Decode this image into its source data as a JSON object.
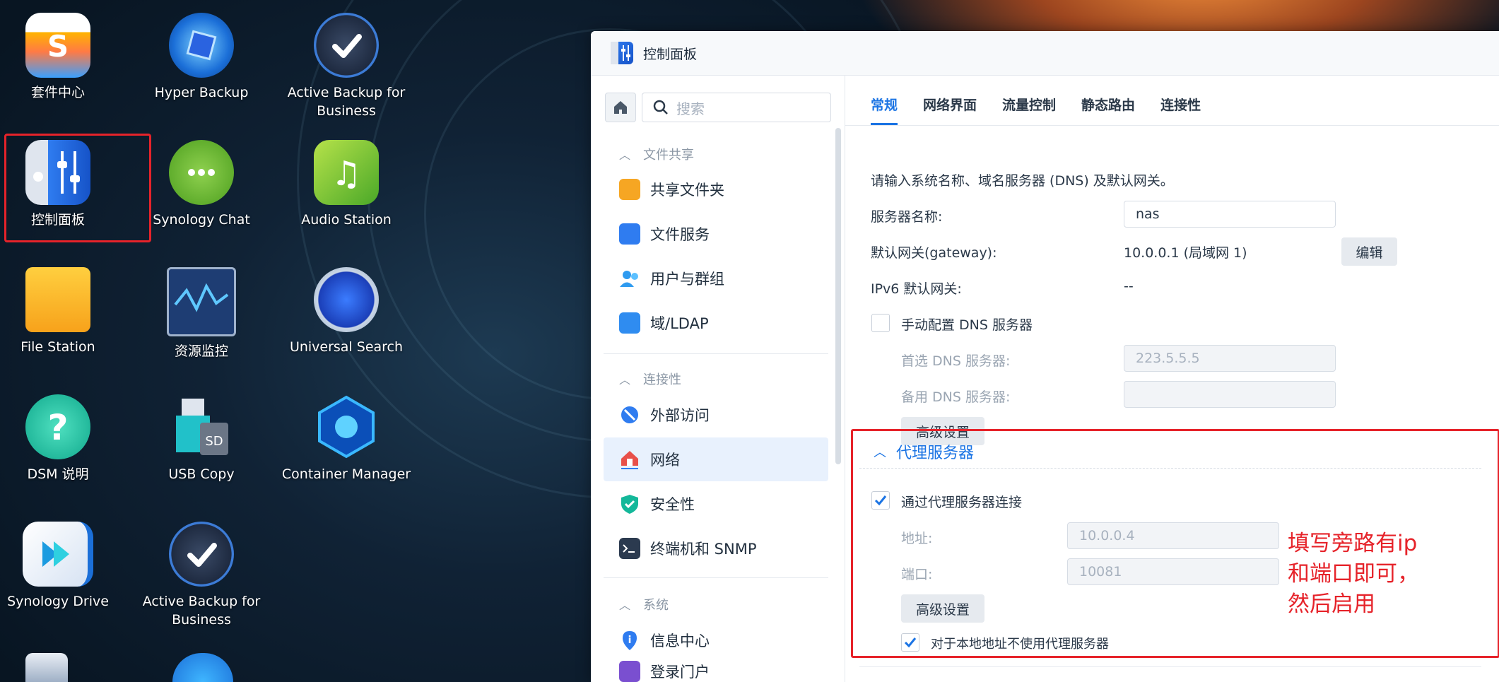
{
  "desktop": {
    "icons": [
      {
        "label": "套件中心"
      },
      {
        "label": "Hyper Backup"
      },
      {
        "label": "Active Backup for Business"
      },
      {
        "label": "控制面板"
      },
      {
        "label": "Synology Chat"
      },
      {
        "label": "Audio Station"
      },
      {
        "label": "File Station"
      },
      {
        "label": "资源监控"
      },
      {
        "label": "Universal Search"
      },
      {
        "label": "DSM 说明"
      },
      {
        "label": "USB Copy"
      },
      {
        "label": "Container Manager"
      },
      {
        "label": "Synology Drive"
      },
      {
        "label": "Active Backup for Business"
      }
    ],
    "usb_copy_sd": "SD"
  },
  "window": {
    "title": "控制面板",
    "search_placeholder": "搜索",
    "sections": {
      "file_sharing": "文件共享",
      "connectivity": "连接性",
      "system": "系统"
    },
    "nav": {
      "shared_folder": "共享文件夹",
      "file_services": "文件服务",
      "users_groups": "用户与群组",
      "domain_ldap": "域/LDAP",
      "external_access": "外部访问",
      "network": "网络",
      "security": "安全性",
      "terminal_snmp": "终端机和 SNMP",
      "info_center": "信息中心",
      "login_portal": "登录门户"
    },
    "tabs": [
      "常规",
      "网络界面",
      "流量控制",
      "静态路由",
      "连接性"
    ],
    "general": {
      "intro": "请输入系统名称、域名服务器 (DNS) 及默认网关。",
      "server_name_label": "服务器名称:",
      "server_name_value": "nas",
      "gateway_label": "默认网关(gateway):",
      "gateway_value": "10.0.0.1 (局域网 1)",
      "edit_label": "编辑",
      "ipv6_label": "IPv6 默认网关:",
      "ipv6_value": "--",
      "manual_dns_label": "手动配置 DNS 服务器",
      "preferred_dns_label": "首选 DNS 服务器:",
      "preferred_dns_value": "223.5.5.5",
      "alt_dns_label": "备用 DNS 服务器:",
      "alt_dns_value": "",
      "advanced_label": "高级设置"
    },
    "proxy": {
      "title": "代理服务器",
      "connect_via_proxy_label": "通过代理服务器连接",
      "connect_via_proxy_checked": true,
      "address_label": "地址:",
      "address_value": "10.0.0.4",
      "port_label": "端口:",
      "port_value": "10081",
      "advanced_label": "高级设置",
      "bypass_local_label": "对于本地地址不使用代理服务器",
      "bypass_local_checked": true
    }
  },
  "annotation": "填写旁路有ip和端口即可，然后启用",
  "colors": {
    "accent": "#1b74e4",
    "highlight": "#e6232a"
  }
}
